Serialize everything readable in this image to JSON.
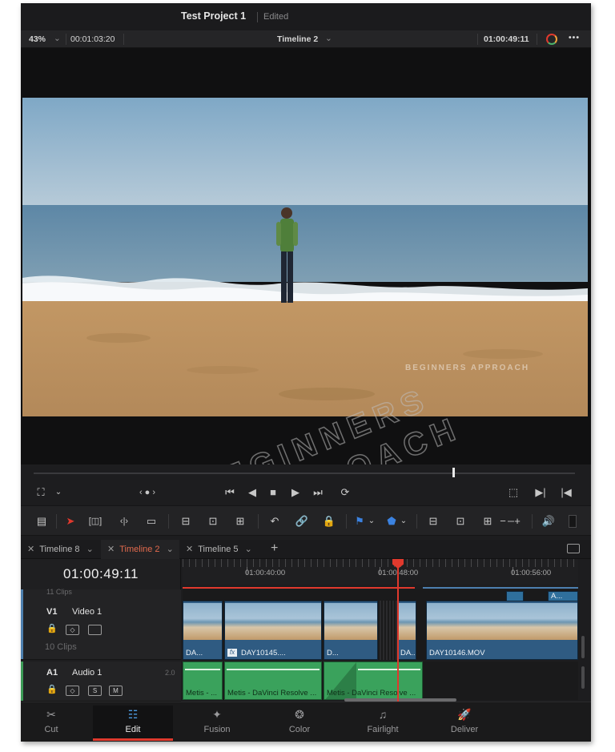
{
  "titlebar": {
    "project": "Test Project 1",
    "status": "Edited"
  },
  "viewerbar": {
    "zoom": "43%",
    "source_timecode": "00:01:03:20",
    "timeline_name": "Timeline 2",
    "record_timecode": "01:00:49:11"
  },
  "watermark": {
    "small": "BEGINNERS APPROACH",
    "large_line1": "BEGINNERS",
    "large_line2": "APPROACH"
  },
  "tabs": [
    {
      "label": "Timeline 8",
      "active": false
    },
    {
      "label": "Timeline 2",
      "active": true
    },
    {
      "label": "Timeline 5",
      "active": false
    }
  ],
  "timeline": {
    "timecode": "01:00:49:11",
    "ruler_labels": [
      "01:00:40:00",
      "01:00:48:00",
      "01:00:56:00"
    ],
    "v1": {
      "id": "V1",
      "name": "Video 1",
      "clip_count": "10 Clips",
      "upper_clips_label": "11 Clips"
    },
    "a1": {
      "id": "A1",
      "name": "Audio 1",
      "channels": "2.0"
    },
    "video_clips": [
      "DA...",
      "DAY10145....",
      "D...",
      "DA...",
      "DAY10146.MOV"
    ],
    "upper_clip": "A...",
    "audio_clips": [
      "Metis - ...",
      "Metis - DaVinci Resolve ...",
      "Metis - DaVinci Resolve ..."
    ],
    "solo_label": "S",
    "mute_label": "M",
    "fx_badge": "fx"
  },
  "pages": [
    {
      "label": "Cut",
      "icon": "cut-page-icon"
    },
    {
      "label": "Edit",
      "icon": "edit-page-icon"
    },
    {
      "label": "Fusion",
      "icon": "fusion-page-icon"
    },
    {
      "label": "Color",
      "icon": "color-page-icon"
    },
    {
      "label": "Fairlight",
      "icon": "fairlight-page-icon"
    },
    {
      "label": "Deliver",
      "icon": "deliver-page-icon"
    }
  ],
  "active_page": "Edit",
  "colors": {
    "accent": "#e0392d",
    "active_tab": "#e26a4d",
    "video_clip": "#2f5b82",
    "audio_clip": "#3aa25c",
    "background": "#1d1d1f"
  }
}
